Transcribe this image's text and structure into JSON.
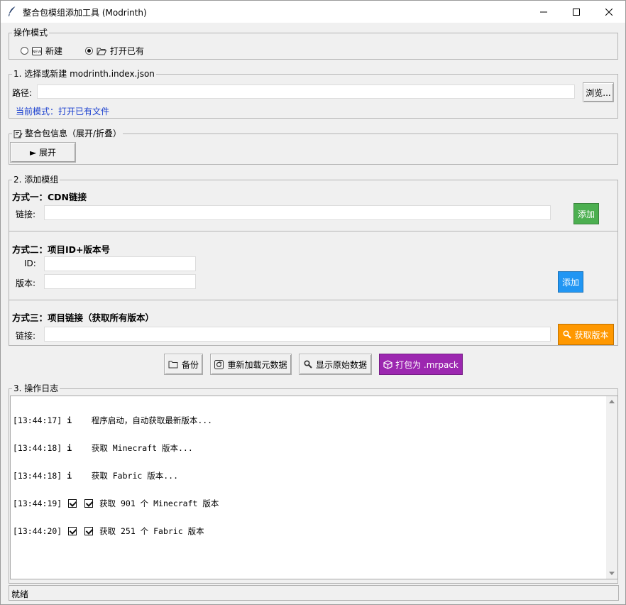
{
  "window": {
    "title": "整合包模组添加工具 (Modrinth)"
  },
  "mode": {
    "legend": "操作模式",
    "options": [
      {
        "label": "新建",
        "selected": false,
        "icon": "new-icon"
      },
      {
        "label": "打开已有",
        "selected": true,
        "icon": "folder-open-icon"
      }
    ]
  },
  "select_file": {
    "legend": "1. 选择或新建 modrinth.index.json",
    "path_label": "路径:",
    "path_value": "",
    "browse_label": "浏览...",
    "current_mode": "当前模式：打开已有文件"
  },
  "pack_info": {
    "legend": "整合包信息（展开/折叠）",
    "expand_label": "► 展开"
  },
  "add_mods": {
    "legend": "2. 添加模组",
    "method1": {
      "title": "方式一：CDN链接",
      "link_label": "链接:",
      "link_value": "",
      "add_label": "添加",
      "color": "#4caf50"
    },
    "method2": {
      "title": "方式二：项目ID+版本号",
      "id_label": "ID:",
      "id_value": "",
      "version_label": "版本:",
      "version_value": "",
      "add_label": "添加",
      "color": "#2196f3"
    },
    "method3": {
      "title": "方式三：项目链接（获取所有版本）",
      "link_label": "链接:",
      "link_value": "",
      "fetch_label": "获取版本",
      "color": "#ff9800"
    }
  },
  "actions": {
    "backup_label": "备份",
    "reload_label": "重新加载元数据",
    "show_raw_label": "显示原始数据",
    "pack_label": "打包为 .mrpack",
    "pack_color": "#9c27b0"
  },
  "log": {
    "legend": "3. 操作日志",
    "lines": [
      {
        "time": "[13:44:17]",
        "icon": "info",
        "text": "程序启动，自动获取最新版本..."
      },
      {
        "time": "[13:44:18]",
        "icon": "info",
        "text": "获取 Minecraft 版本..."
      },
      {
        "time": "[13:44:18]",
        "icon": "info",
        "text": "获取 Fabric 版本..."
      },
      {
        "time": "[13:44:19]",
        "icon": "check",
        "text": "获取 901 个 Minecraft 版本"
      },
      {
        "time": "[13:44:20]",
        "icon": "check",
        "text": "获取 251 个 Fabric 版本"
      }
    ]
  },
  "status": {
    "text": "就绪"
  }
}
